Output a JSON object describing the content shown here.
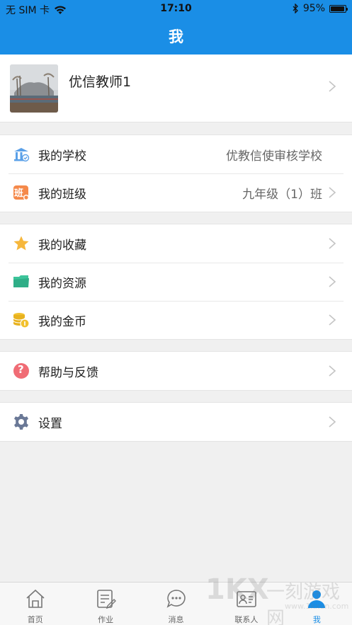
{
  "status_bar": {
    "carrier": "无 SIM 卡",
    "time": "17:10",
    "battery": "95%",
    "battery_level": 0.95
  },
  "header": {
    "title": "我"
  },
  "profile": {
    "name": "优信教师1"
  },
  "groups": [
    {
      "items": [
        {
          "label": "我的学校",
          "value": "优教信使审核学校",
          "icon": "school-icon"
        },
        {
          "label": "我的班级",
          "value": "九年级（1）班",
          "icon": "class-icon",
          "icon_text": "班"
        }
      ]
    },
    {
      "items": [
        {
          "label": "我的收藏",
          "icon": "star-icon"
        },
        {
          "label": "我的资源",
          "icon": "folder-icon"
        },
        {
          "label": "我的金币",
          "icon": "coins-icon"
        }
      ]
    },
    {
      "items": [
        {
          "label": "帮助与反馈",
          "icon": "help-icon",
          "icon_text": "?"
        }
      ]
    },
    {
      "items": [
        {
          "label": "设置",
          "icon": "gear-icon"
        }
      ]
    }
  ],
  "tabbar": {
    "tabs": [
      {
        "label": "首页",
        "icon": "home-icon"
      },
      {
        "label": "作业",
        "icon": "homework-icon"
      },
      {
        "label": "消息",
        "icon": "message-icon"
      },
      {
        "label": "联系人",
        "icon": "contacts-icon"
      },
      {
        "label": "我",
        "icon": "profile-icon",
        "active": true
      }
    ]
  },
  "watermark": {
    "logo": "1KX",
    "text": "一刻游戏网",
    "url": "www.1kxun.com"
  },
  "colors": {
    "brand": "#1a8ee6",
    "background": "#f0f0f0",
    "star": "#f6b73c",
    "folder": "#3cc49a",
    "coins": "#f2c12e",
    "help": "#f06c75",
    "class": "#f5894a",
    "school": "#5aa0e8",
    "gear": "#6a7896"
  }
}
